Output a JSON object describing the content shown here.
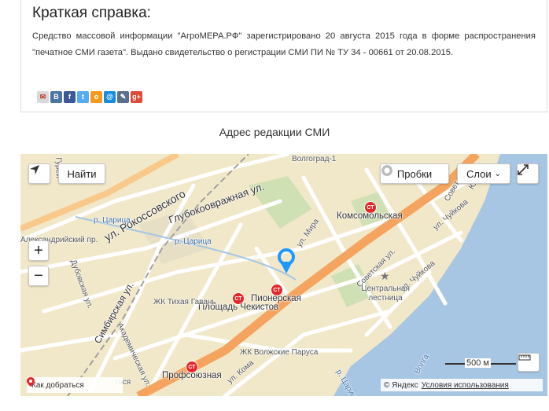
{
  "info": {
    "title": "Краткая справка:",
    "body": "Средство массовой информации \"АгроМЕРА.РФ\" зарегистрировано 20 августа 2015 года в форме распространения \"печатное СМИ газета\". Выдано свидетельство о регистрации СМИ ПИ № ТУ 34 - 00661 от 20.08.2015.",
    "share_icons": [
      {
        "name": "vk-plain-icon",
        "glyph": "✉",
        "color": "#d8d8d8"
      },
      {
        "name": "vkontakte-icon",
        "glyph": "В",
        "color": "#4c75a3"
      },
      {
        "name": "facebook-icon",
        "glyph": "f",
        "color": "#3b5998"
      },
      {
        "name": "twitter-icon",
        "glyph": "t",
        "color": "#55acee"
      },
      {
        "name": "odnoklassniki-icon",
        "glyph": "о",
        "color": "#f59a1e"
      },
      {
        "name": "mailru-icon",
        "glyph": "@",
        "color": "#168de2"
      },
      {
        "name": "livejournal-icon",
        "glyph": "✎",
        "color": "#5a6f8c"
      },
      {
        "name": "googleplus-icon",
        "glyph": "g+",
        "color": "#dd4b39"
      }
    ]
  },
  "map_section": {
    "title": "Адрес редакции СМИ"
  },
  "map": {
    "find_button": "Найти",
    "traffic_button": "Пробки",
    "layers_button": "Слои",
    "zoom_in": "+",
    "zoom_out": "−",
    "scale_label": "500 м",
    "route_label": "Как добраться",
    "copyright": "© Яндекс",
    "terms_link": "Условия использования",
    "colors": {
      "water": "#a6c6e4",
      "land": "#f1e8c9",
      "main_road": "#f4a45f",
      "road": "#ffffff",
      "park": "#cfe0b4",
      "marker": "#1e98ff",
      "metro": "#e4262b"
    },
    "streets": [
      "ул. Рокоссовского",
      "Глубокоовражная ул.",
      "Симбирская ул.",
      "Академическая ул.",
      "Дубовская ул.",
      "Александрийский пр.",
      "ул. Мира",
      "Советская ул.",
      "ул. Чуйкова",
      "Волгоград-1",
      "Совет",
      "Гурей",
      "ул. Кома",
      "Юрьев",
      "ул."
    ],
    "metro_stations": [
      "Комсомольская",
      "Пионерская",
      "Площадь Чекистов",
      "Профсоюзная"
    ],
    "places": [
      "ЖК Тихая Гавань",
      "ЖК Волжские Паруса",
      "Центральная лестница"
    ],
    "water_labels": [
      "р. Царица",
      "р. Царица",
      "Волга",
      "р. Царица"
    ],
    "tram_label": "т",
    "more_label": "ться"
  }
}
